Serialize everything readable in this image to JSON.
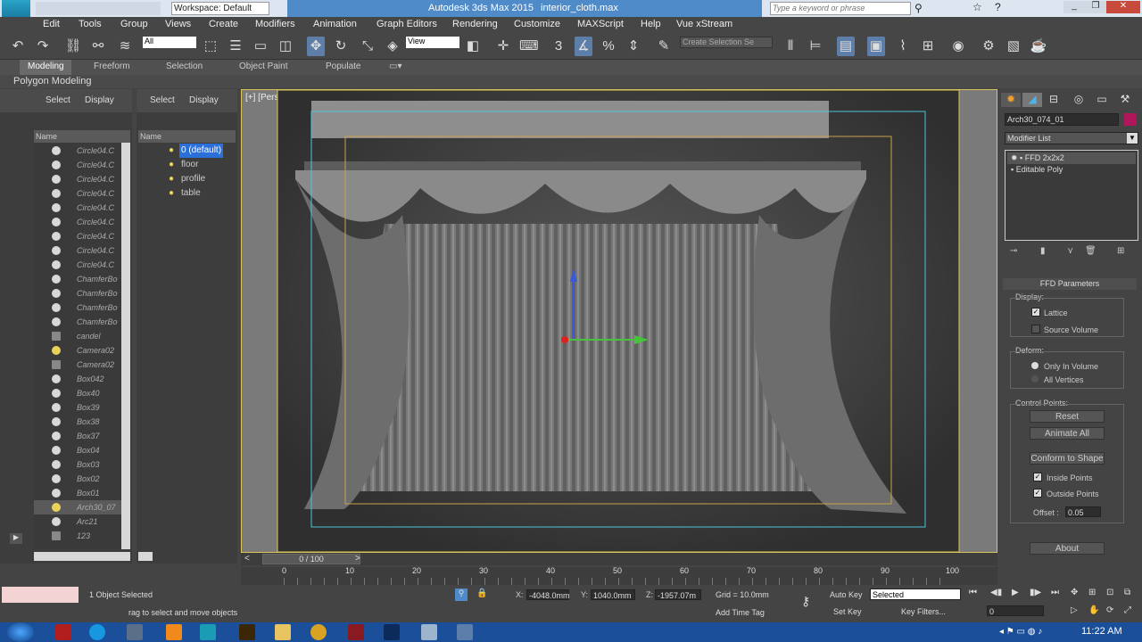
{
  "title": {
    "workspace": "Workspace: Default",
    "app": "Autodesk 3ds Max  2015",
    "file": "interior_cloth.max",
    "search_placeholder": "Type a keyword or phrase"
  },
  "menu": [
    "Edit",
    "Tools",
    "Group",
    "Views",
    "Create",
    "Modifiers",
    "Animation",
    "Graph Editors",
    "Rendering",
    "Customize",
    "MAXScript",
    "Help",
    "Vue xStream"
  ],
  "toolbar": {
    "filter": "All",
    "ref_coord": "View",
    "selection_set": "Create Selection Se"
  },
  "ribbon": {
    "tabs": [
      "Modeling",
      "Freeform",
      "Selection",
      "Object Paint",
      "Populate"
    ],
    "sub": "Polygon Modeling"
  },
  "scene_explorer": {
    "select": "Select",
    "display": "Display",
    "name_col": "Name",
    "items": [
      "Circle04.C",
      "Circle04.C",
      "Circle04.C",
      "Circle04.C",
      "Circle04.C",
      "Circle04.C",
      "Circle04.C",
      "Circle04.C",
      "Circle04.C",
      "ChamferBo",
      "ChamferBo",
      "ChamferBo",
      "ChamferBo",
      "candel",
      "Camera02",
      "Camera02",
      "Box042",
      "Box40",
      "Box39",
      "Box38",
      "Box37",
      "Box04",
      "Box03",
      "Box02",
      "Box01",
      "Arch30_07",
      "Arc21",
      "123"
    ]
  },
  "layer_explorer": {
    "select": "Select",
    "display": "Display",
    "name_col": "Name",
    "layers": [
      "0 (default)",
      "floor",
      "profile",
      "table"
    ]
  },
  "viewport": {
    "label": "[+] [Perspective ] [Shaded]"
  },
  "command_panel": {
    "object_name": "Arch30_074_01",
    "modifier_list": "Modifier List",
    "stack": [
      "FFD 2x2x2",
      "Editable Poly"
    ],
    "ffd": {
      "title": "FFD Parameters",
      "display": "Display:",
      "lattice": "Lattice",
      "source_volume": "Source Volume",
      "deform": "Deform:",
      "only_in_volume": "Only In Volume",
      "all_vertices": "All Vertices",
      "control_points": "Control Points:",
      "reset": "Reset",
      "animate_all": "Animate All",
      "conform": "Conform to Shape",
      "inside": "Inside Points",
      "outside": "Outside Points",
      "offset_label": "Offset :",
      "offset": "0.05",
      "about": "About"
    },
    "lattice_checked": true,
    "source_checked": false,
    "inside_checked": true,
    "outside_checked": true
  },
  "timeline": {
    "frame": "0 / 100",
    "ticks": [
      "0",
      "10",
      "20",
      "30",
      "40",
      "50",
      "60",
      "70",
      "80",
      "90",
      "100"
    ]
  },
  "status": {
    "selected": "1 Object Selected",
    "prompt": "rag to select and move objects",
    "x": "-4048.0mm",
    "y": "1040.0mm",
    "z": "-1957.07m",
    "grid": "Grid = 10.0mm",
    "auto_key": "Auto Key",
    "key_mode": "Selected",
    "set_key": "Set Key",
    "key_filters": "Key Filters...",
    "add_time_tag": "Add Time Tag",
    "frame_field": "0"
  },
  "taskbar": {
    "time": "11:22 AM"
  }
}
